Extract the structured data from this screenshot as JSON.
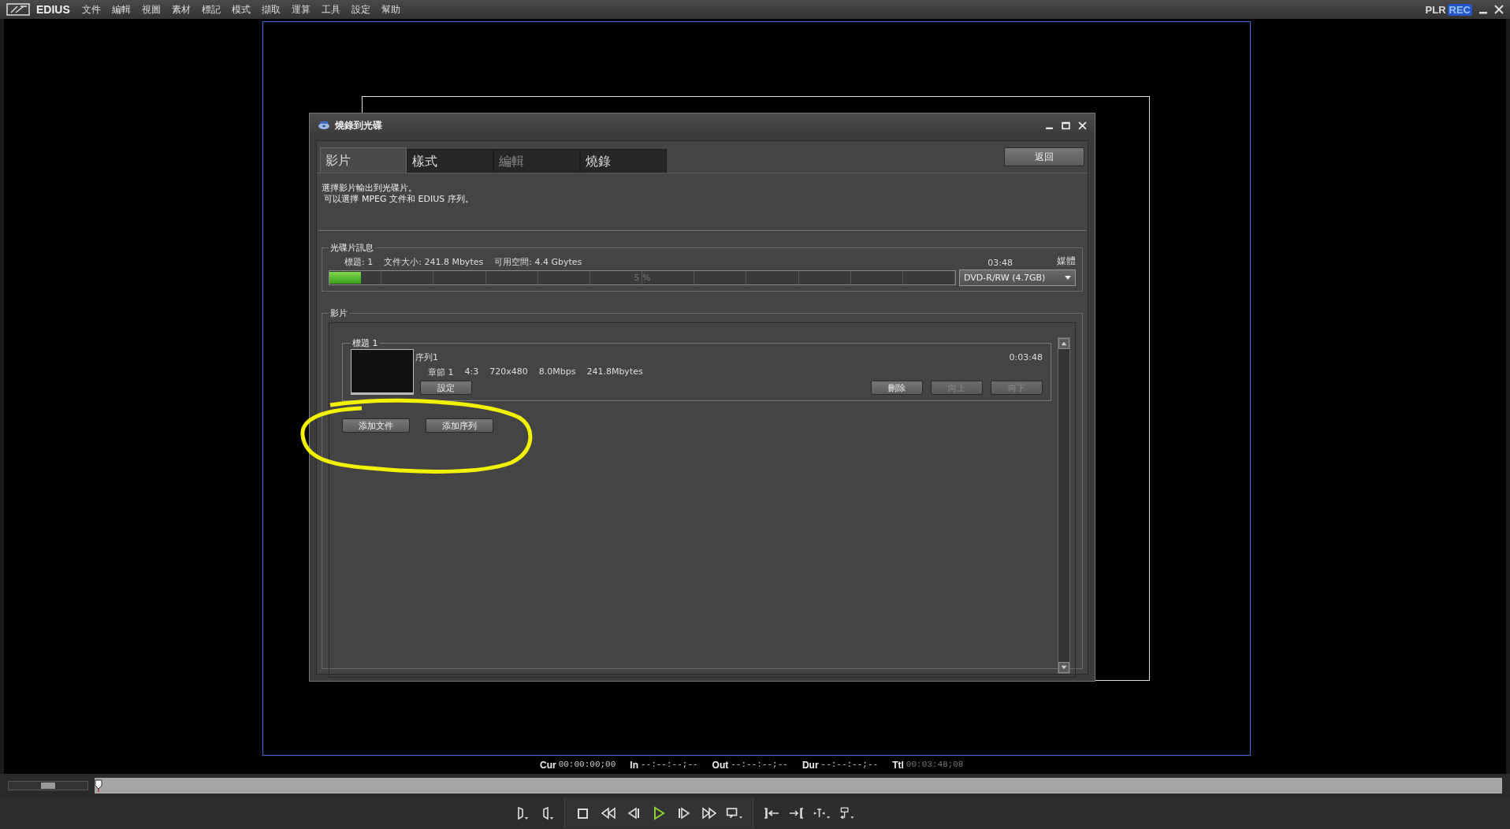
{
  "menu_bar": {
    "app_name": "EDIUS",
    "items": [
      "文件",
      "編輯",
      "視圖",
      "素材",
      "標記",
      "模式",
      "擷取",
      "運算",
      "工具",
      "設定",
      "幫助"
    ],
    "modes": [
      {
        "label": "PLR",
        "selected": false
      },
      {
        "label": "REC",
        "selected": true
      }
    ]
  },
  "dialog": {
    "title": "燒錄到光碟",
    "tabs": [
      {
        "label": "影片",
        "selected": true,
        "disabled": false
      },
      {
        "label": "樣式",
        "selected": false,
        "disabled": false
      },
      {
        "label": "編輯",
        "selected": false,
        "disabled": true
      },
      {
        "label": "燒錄",
        "selected": false,
        "disabled": false
      }
    ],
    "return_button": "返回",
    "description": [
      "選擇影片輸出到光碟片。",
      " 可以選擇 MPEG 文件和 EDIUS 序列。"
    ],
    "disc_info": {
      "legend": "光碟片訊息",
      "title_count": "標題: 1",
      "file_size": "文件大小: 241.8 Mbytes",
      "free_space": "可用空間: 4.4 Gbytes",
      "duration": "03:48",
      "media_label": "媒體",
      "progress": {
        "level": 0.05,
        "label": "5 %"
      },
      "media_select": "DVD-R/RW (4.7GB)"
    },
    "video": {
      "legend": "影片",
      "titles": [
        {
          "legend": "標題 1",
          "sequence": "序列1",
          "duration": "0:03:48",
          "details": [
            "章節 1",
            "4:3",
            "720x480",
            "8.0Mbps",
            "241.8Mbytes"
          ],
          "settings_button": "設定",
          "buttons": [
            {
              "label": "刪除",
              "disabled": false
            },
            {
              "label": "向上",
              "disabled": true
            },
            {
              "label": "向下",
              "disabled": true
            }
          ]
        }
      ],
      "add_buttons": [
        "添加文件",
        "添加序列"
      ]
    }
  },
  "zoom_slider": {
    "level": 0.5
  },
  "timecodes": [
    {
      "label": "Cur",
      "value": "00:00:00;00",
      "dimmed": false
    },
    {
      "label": "In",
      "value": "--:--:--;--",
      "dimmed": false
    },
    {
      "label": "Out",
      "value": "--:--:--;--",
      "dimmed": false
    },
    {
      "label": "Dur",
      "value": "--:--:--;--",
      "dimmed": false
    },
    {
      "label": "Ttl",
      "value": "00:03:48;08",
      "dimmed": true
    }
  ]
}
